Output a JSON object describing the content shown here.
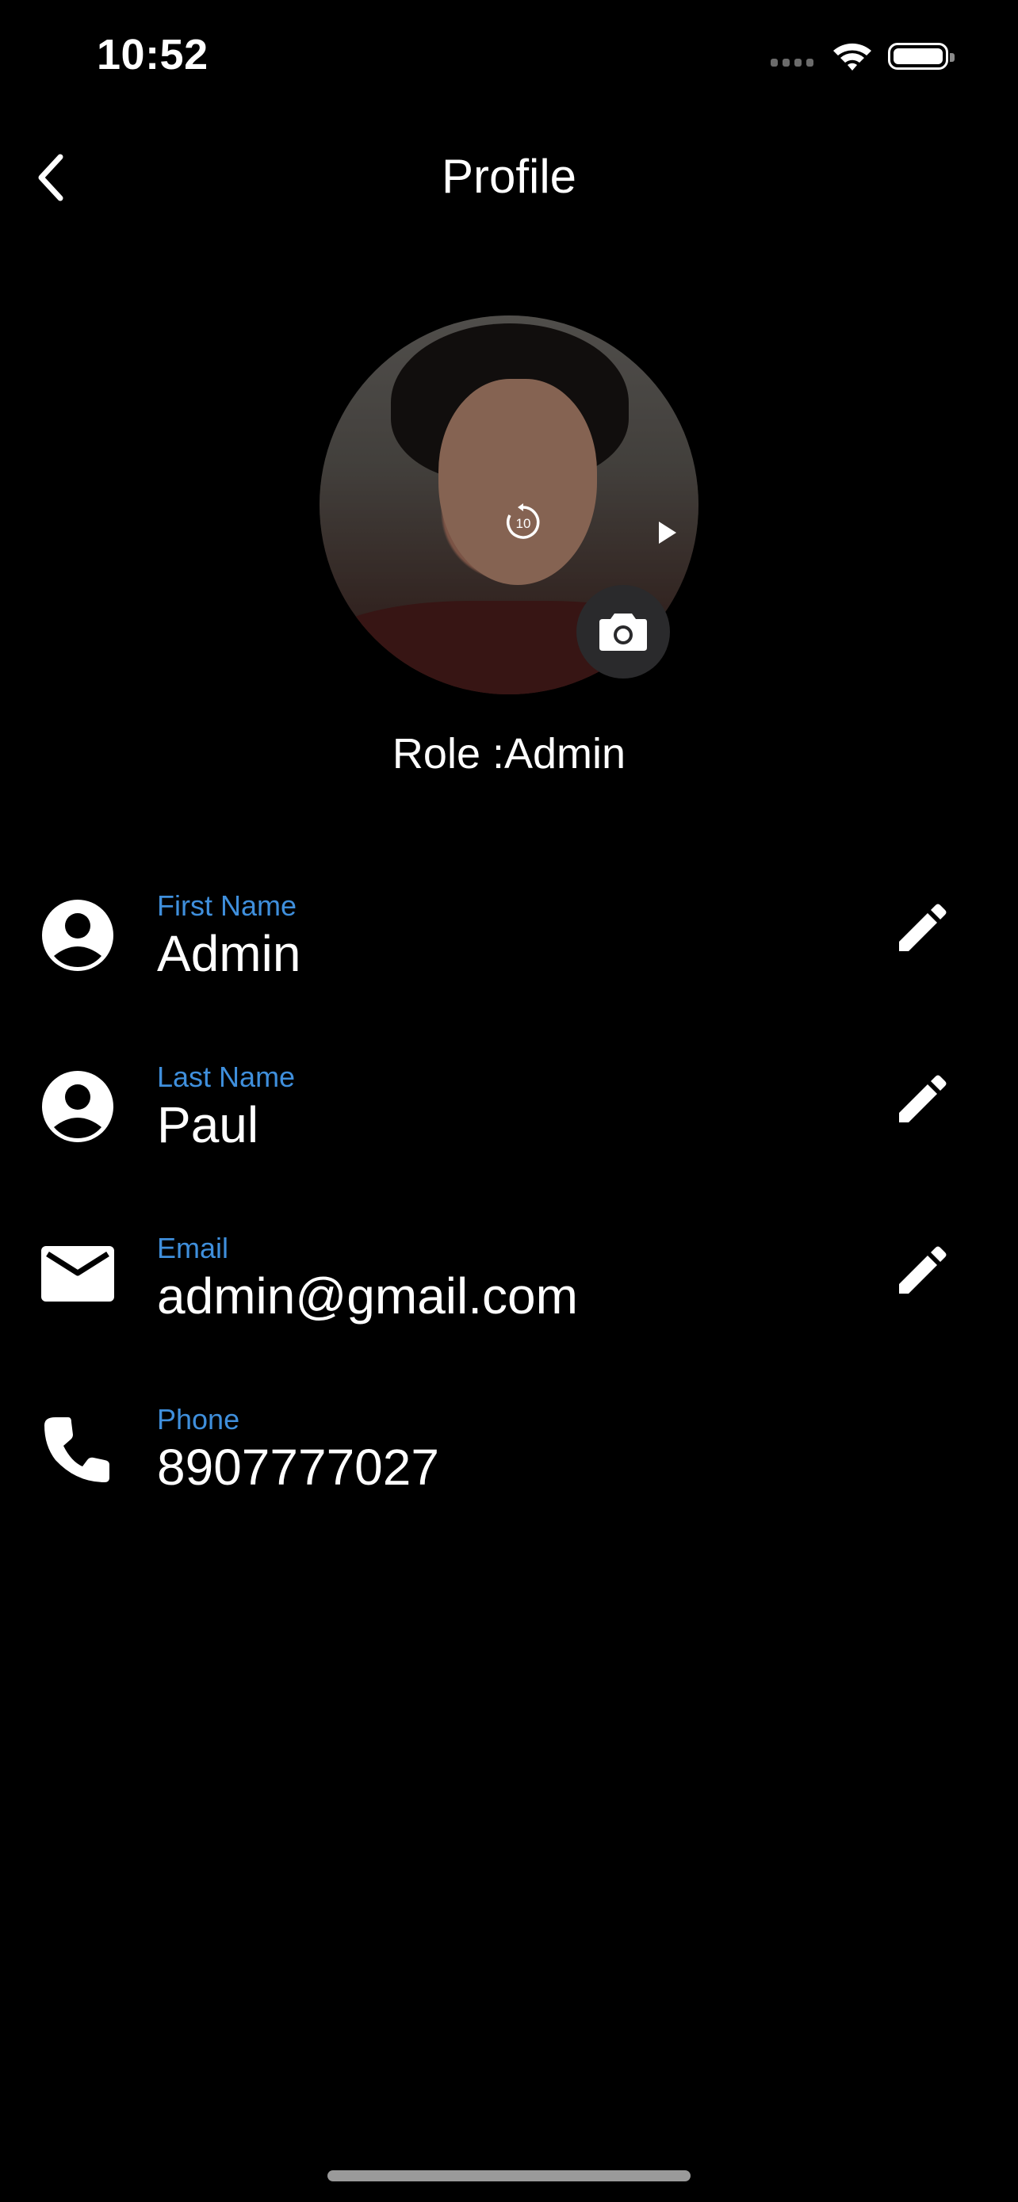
{
  "status_bar": {
    "time": "10:52",
    "icons": [
      "cellular-signal-icon",
      "wifi-icon",
      "battery-icon"
    ]
  },
  "header": {
    "title": "Profile",
    "back_icon": "chevron-left-icon"
  },
  "avatar": {
    "overlay_icons": [
      "replay-10-icon",
      "play-icon"
    ],
    "camera_icon": "camera-icon"
  },
  "role_text": "Role :Admin",
  "fields": [
    {
      "icon": "account-circle-icon",
      "label": "First Name",
      "value": "Admin",
      "editable": true
    },
    {
      "icon": "account-circle-icon",
      "label": "Last Name",
      "value": "Paul",
      "editable": true
    },
    {
      "icon": "mail-icon",
      "label": "Email",
      "value": "admin@gmail.com",
      "editable": true
    },
    {
      "icon": "phone-icon",
      "label": "Phone",
      "value": "8907777027",
      "editable": false
    }
  ],
  "colors": {
    "background": "#000000",
    "label_accent": "#3f8fdc",
    "text": "#ffffff"
  }
}
